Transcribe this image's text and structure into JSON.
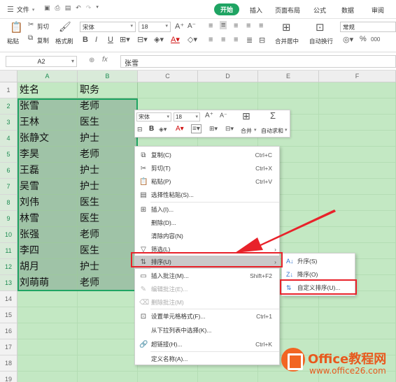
{
  "topbar": {
    "menu_label": "文件",
    "tabs": [
      {
        "label": "开始",
        "active": true
      },
      {
        "label": "插入"
      },
      {
        "label": "页面布局"
      },
      {
        "label": "公式"
      },
      {
        "label": "数据"
      },
      {
        "label": "审阅"
      }
    ]
  },
  "ribbon": {
    "paste": "粘贴",
    "cut": "剪切",
    "copy": "复制",
    "format_painter": "格式刷",
    "font_name": "宋体",
    "font_size": "18",
    "merge_center": "合并居中",
    "wrap_text": "自动换行",
    "number_format": "常规",
    "bold": "B",
    "italic": "I",
    "underline": "U",
    "grow_font": "A⁺",
    "shrink_font": "A⁻",
    "percent": "%",
    "thousands": "000"
  },
  "formula_bar": {
    "name_box": "A2",
    "fx": "fx",
    "content": "张雪"
  },
  "sheet": {
    "columns": [
      "A",
      "B",
      "C",
      "D",
      "E",
      "F"
    ],
    "rows": [
      "1",
      "2",
      "3",
      "4",
      "5",
      "6",
      "7",
      "8",
      "9",
      "10",
      "11",
      "12",
      "13",
      "14",
      "15",
      "16",
      "17",
      "18",
      "19"
    ],
    "data": [
      [
        "姓名",
        "职务"
      ],
      [
        "张雪",
        "老师"
      ],
      [
        "王林",
        "医生"
      ],
      [
        "张静文",
        "护士"
      ],
      [
        "李昊",
        "老师"
      ],
      [
        "王磊",
        "护士"
      ],
      [
        "吴雪",
        "护士"
      ],
      [
        "刘伟",
        "医生"
      ],
      [
        "林雪",
        "医生"
      ],
      [
        "张强",
        "老师"
      ],
      [
        "李四",
        "医生"
      ],
      [
        "胡月",
        "护士"
      ],
      [
        "刘萌萌",
        "老师"
      ]
    ]
  },
  "mini_toolbar": {
    "font": "宋体",
    "size": "18",
    "merge": "合并",
    "autosum": "自动求和"
  },
  "context_menu": [
    {
      "label": "复制(C)",
      "shortcut": "Ctrl+C",
      "icon": "copy-icon"
    },
    {
      "label": "剪切(T)",
      "shortcut": "Ctrl+X",
      "icon": "scissors-icon"
    },
    {
      "label": "粘贴(P)",
      "shortcut": "Ctrl+V",
      "icon": "paste-icon"
    },
    {
      "label": "选择性粘贴(S)...",
      "shortcut": "",
      "icon": "paste-special-icon"
    },
    {
      "label": "插入(I)...",
      "shortcut": "",
      "icon": "insert-icon"
    },
    {
      "label": "删除(D)...",
      "shortcut": "",
      "icon": ""
    },
    {
      "label": "清除内容(N)",
      "shortcut": "",
      "icon": ""
    },
    {
      "label": "筛选(L)",
      "shortcut": "",
      "icon": "filter-icon"
    },
    {
      "label": "排序(U)",
      "shortcut": "",
      "icon": "sort-icon"
    },
    {
      "label": "插入批注(M)...",
      "shortcut": "Shift+F2",
      "icon": "comment-icon"
    },
    {
      "label": "编辑批注(E)...",
      "shortcut": "",
      "icon": "edit-comment-icon"
    },
    {
      "label": "删除批注(M)",
      "shortcut": "",
      "icon": "delete-comment-icon"
    },
    {
      "label": "设置单元格格式(F)...",
      "shortcut": "Ctrl+1",
      "icon": "format-cells-icon"
    },
    {
      "label": "从下拉列表中选择(K)...",
      "shortcut": "",
      "icon": ""
    },
    {
      "label": "超链接(H)...",
      "shortcut": "Ctrl+K",
      "icon": "link-icon"
    },
    {
      "label": "定义名称(A)...",
      "shortcut": "",
      "icon": ""
    }
  ],
  "sort_submenu": [
    {
      "label": "升序(S)",
      "icon": "sort-ascending-icon"
    },
    {
      "label": "降序(O)",
      "icon": "sort-descending-icon"
    },
    {
      "label": "自定义排序(U)...",
      "icon": "custom-sort-icon"
    }
  ],
  "watermark": {
    "brand": "Office教程网",
    "url": "www.office26.com"
  },
  "colors": {
    "accent_green": "#1fa463",
    "selection": "#9fc3a7",
    "sheet_bg": "#c3e8c3",
    "highlight_red": "#e8222a",
    "watermark_orange": "#e8591d"
  }
}
